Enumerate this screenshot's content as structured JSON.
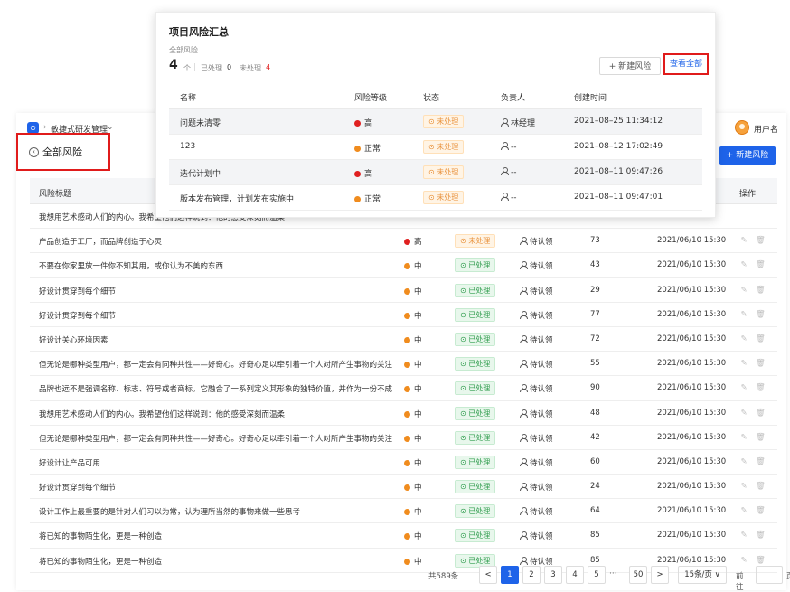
{
  "colors": {
    "accent": "#1e63e9",
    "high": "#e02020",
    "medium": "#f08c1e",
    "done": "#2f9c4d",
    "pending": "#e8913a",
    "highlight": "#e01b1b"
  },
  "topbar": {
    "project_name": "敏捷式研发管理",
    "username": "用户名",
    "app_icon": "app-logo-icon"
  },
  "page": {
    "title": "全部风险",
    "new_risk_button": "+ 新建风险"
  },
  "table": {
    "headers": {
      "title": "风险标题",
      "ops": "操作"
    },
    "rows": [
      {
        "title": "我想用艺术感动人们的内心。我希望他们这样说到：他的感受深刻而温柔",
        "level": "",
        "status": "",
        "owner": "",
        "count": "",
        "date": ""
      },
      {
        "title": "产品创造于工厂，而品牌创造于心灵",
        "level": "高",
        "status": "未处理",
        "owner": "待认领",
        "count": "73",
        "date": "2021/06/10 15:30"
      },
      {
        "title": "不要在你家里放一件你不知其用，或你认为不美的东西",
        "level": "中",
        "status": "已处理",
        "owner": "待认领",
        "count": "43",
        "date": "2021/06/10 15:30"
      },
      {
        "title": "好设计贯穿到每个细节",
        "level": "中",
        "status": "已处理",
        "owner": "待认领",
        "count": "29",
        "date": "2021/06/10 15:30"
      },
      {
        "title": "好设计贯穿到每个细节",
        "level": "中",
        "status": "已处理",
        "owner": "待认领",
        "count": "77",
        "date": "2021/06/10 15:30"
      },
      {
        "title": "好设计关心环境因素",
        "level": "中",
        "status": "已处理",
        "owner": "待认领",
        "count": "72",
        "date": "2021/06/10 15:30"
      },
      {
        "title": "但无论是哪种类型用户，都一定会有同种共性——好奇心。好奇心足以牵引着一个人对所产生事物的关注",
        "level": "中",
        "status": "已处理",
        "owner": "待认领",
        "count": "55",
        "date": "2021/06/10 15:30"
      },
      {
        "title": "品牌也远不是强调名称、标志、符号或者商标。它融合了一系列定义其形象的独特价值，并作为一份不成",
        "level": "中",
        "status": "已处理",
        "owner": "待认领",
        "count": "90",
        "date": "2021/06/10 15:30"
      },
      {
        "title": "我想用艺术感动人们的内心。我希望他们这样说到：他的感受深刻而温柔",
        "level": "中",
        "status": "已处理",
        "owner": "待认领",
        "count": "48",
        "date": "2021/06/10 15:30"
      },
      {
        "title": "但无论是哪种类型用户，都一定会有同种共性——好奇心。好奇心足以牵引着一个人对所产生事物的关注",
        "level": "中",
        "status": "已处理",
        "owner": "待认领",
        "count": "42",
        "date": "2021/06/10 15:30"
      },
      {
        "title": "好设计让产品可用",
        "level": "中",
        "status": "已处理",
        "owner": "待认领",
        "count": "60",
        "date": "2021/06/10 15:30"
      },
      {
        "title": "好设计贯穿到每个细节",
        "level": "中",
        "status": "已处理",
        "owner": "待认领",
        "count": "24",
        "date": "2021/06/10 15:30"
      },
      {
        "title": "设计工作上最重要的是针对人们习以为常，认为理所当然的事物来做一些思考",
        "level": "中",
        "status": "已处理",
        "owner": "待认领",
        "count": "64",
        "date": "2021/06/10 15:30"
      },
      {
        "title": "将已知的事物陌生化，更是一种创造",
        "level": "中",
        "status": "已处理",
        "owner": "待认领",
        "count": "85",
        "date": "2021/06/10 15:30"
      },
      {
        "title": "将已知的事物陌生化，更是一种创造",
        "level": "中",
        "status": "已处理",
        "owner": "待认领",
        "count": "85",
        "date": "2021/06/10 15:30"
      }
    ]
  },
  "pagination": {
    "total": "共589条",
    "prev": "<",
    "pages": [
      "1",
      "2",
      "3",
      "4",
      "5"
    ],
    "ellipsis": "···",
    "last": "50",
    "next": ">",
    "page_size": "15条/页 ∨",
    "goto_label": "前往",
    "page_suffix": "页"
  },
  "popup": {
    "title": "项目风险汇总",
    "subtitle": "全部风险",
    "count": "4",
    "count_unit": "个",
    "handled_label": "已处理",
    "handled_value": "0",
    "unhandled_label": "未处理",
    "unhandled_value": "4",
    "new_button": "+ 新建风险",
    "view_all": "查看全部",
    "headers": {
      "name": "名称",
      "level": "风险等级",
      "status": "状态",
      "owner": "负责人",
      "created": "创建时间"
    },
    "rows": [
      {
        "name": "问题未清零",
        "level": "高",
        "status": "未处理",
        "owner": "林经理",
        "created": "2021–08–25 11:34:12"
      },
      {
        "name": "123",
        "level": "正常",
        "status": "未处理",
        "owner": "--",
        "created": "2021–08–12 17:02:49"
      },
      {
        "name": "迭代计划中",
        "level": "高",
        "status": "未处理",
        "owner": "--",
        "created": "2021–08–11 09:47:26"
      },
      {
        "name": "版本发布管理，计划发布实施中",
        "level": "正常",
        "status": "未处理",
        "owner": "--",
        "created": "2021–08–11 09:47:01"
      }
    ]
  }
}
